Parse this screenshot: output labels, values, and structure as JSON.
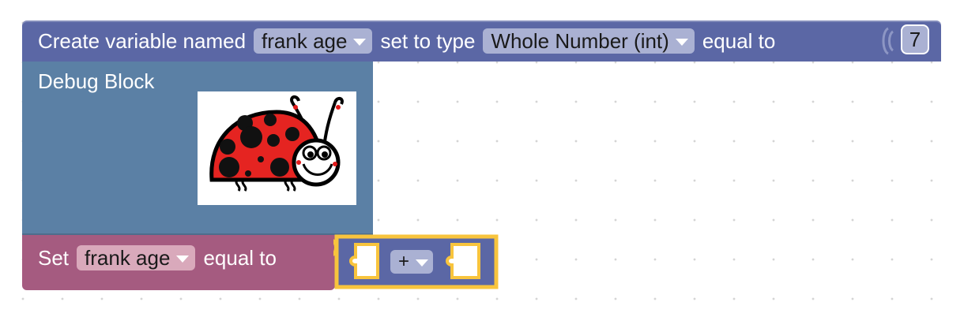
{
  "create_variable": {
    "label_prefix": "Create variable named",
    "var_name": "frank age",
    "label_type": "set to type",
    "type_value": "Whole Number (int)",
    "label_equal": "equal to",
    "value": "7"
  },
  "debug_block": {
    "label": "Debug Block",
    "image": "ladybug"
  },
  "set_block": {
    "label_set": "Set",
    "var_name": "frank age",
    "label_equal": "equal to"
  },
  "operator_block": {
    "operator": "+"
  },
  "colors": {
    "create_variable_block": "#5b67a5",
    "debug_block": "#5b80a5",
    "set_block": "#a55b80",
    "selected_outline": "#f8c43d"
  }
}
